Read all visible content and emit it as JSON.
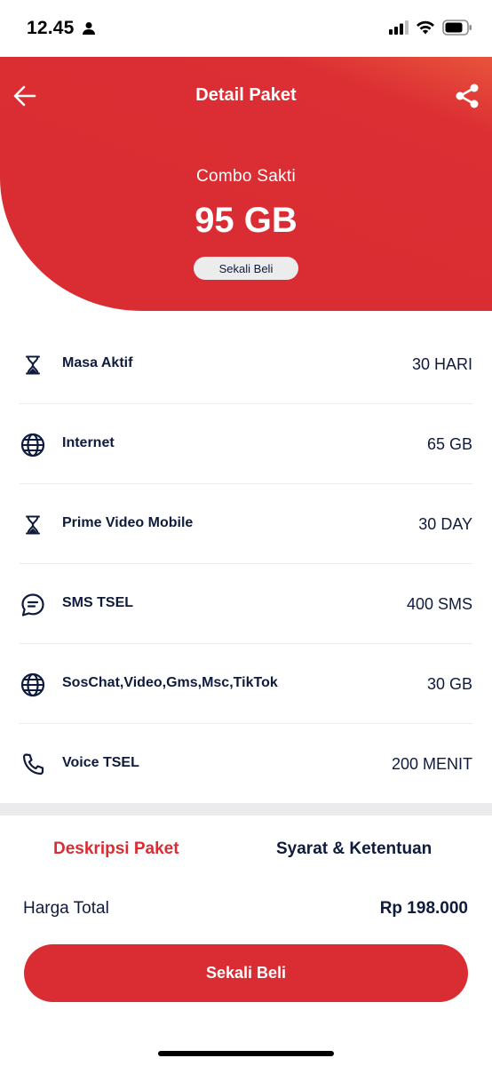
{
  "status_bar": {
    "time": "12.45"
  },
  "header": {
    "title": "Detail Paket"
  },
  "package": {
    "name": "Combo Sakti",
    "size": "95 GB",
    "badge": "Sekali Beli"
  },
  "benefits": [
    {
      "icon": "hourglass-icon",
      "label": "Masa Aktif",
      "value": "30 HARI"
    },
    {
      "icon": "globe-icon",
      "label": "Internet",
      "value": "65 GB"
    },
    {
      "icon": "hourglass-icon",
      "label": "Prime Video Mobile",
      "value": "30 DAY"
    },
    {
      "icon": "chat-bubble-icon",
      "label": "SMS TSEL",
      "value": "400 SMS"
    },
    {
      "icon": "globe-icon",
      "label": "SosChat,Video,Gms,Msc,TikTok",
      "value": "30 GB"
    },
    {
      "icon": "phone-icon",
      "label": "Voice TSEL",
      "value": "200 MENIT"
    }
  ],
  "tabs": {
    "description": "Deskripsi Paket",
    "terms": "Syarat & Ketentuan"
  },
  "total": {
    "label": "Harga Total",
    "value": "Rp 198.000"
  },
  "buy_button": {
    "label": "Sekali Beli"
  },
  "colors": {
    "primary": "#d92d33",
    "text": "#0f1b3d"
  }
}
